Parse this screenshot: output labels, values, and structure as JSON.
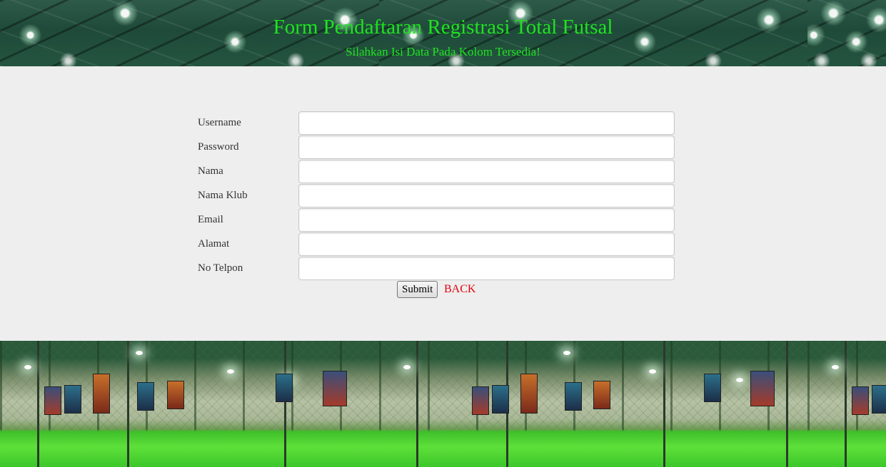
{
  "header": {
    "title": "Form Pendaftaran Registrasi Total Futsal",
    "subtitle": "Silahkan Isi Data Pada Kolom Tersedia!"
  },
  "form": {
    "fields": [
      {
        "label": "Username",
        "value": "",
        "placeholder": ""
      },
      {
        "label": "Password",
        "value": "",
        "placeholder": ""
      },
      {
        "label": "Nama",
        "value": "",
        "placeholder": ""
      },
      {
        "label": "Nama Klub",
        "value": "",
        "placeholder": ""
      },
      {
        "label": "Email",
        "value": "",
        "placeholder": ""
      },
      {
        "label": "Alamat",
        "value": "",
        "placeholder": ""
      },
      {
        "label": "No Telpon",
        "value": "",
        "placeholder": ""
      }
    ],
    "submit_label": "Submit",
    "back_label": "BACK"
  },
  "colors": {
    "title_text": "#1fe31f",
    "panel_background": "#eeeeee",
    "back_link": "#e2000f"
  },
  "background_image": "futsal-court-photo"
}
